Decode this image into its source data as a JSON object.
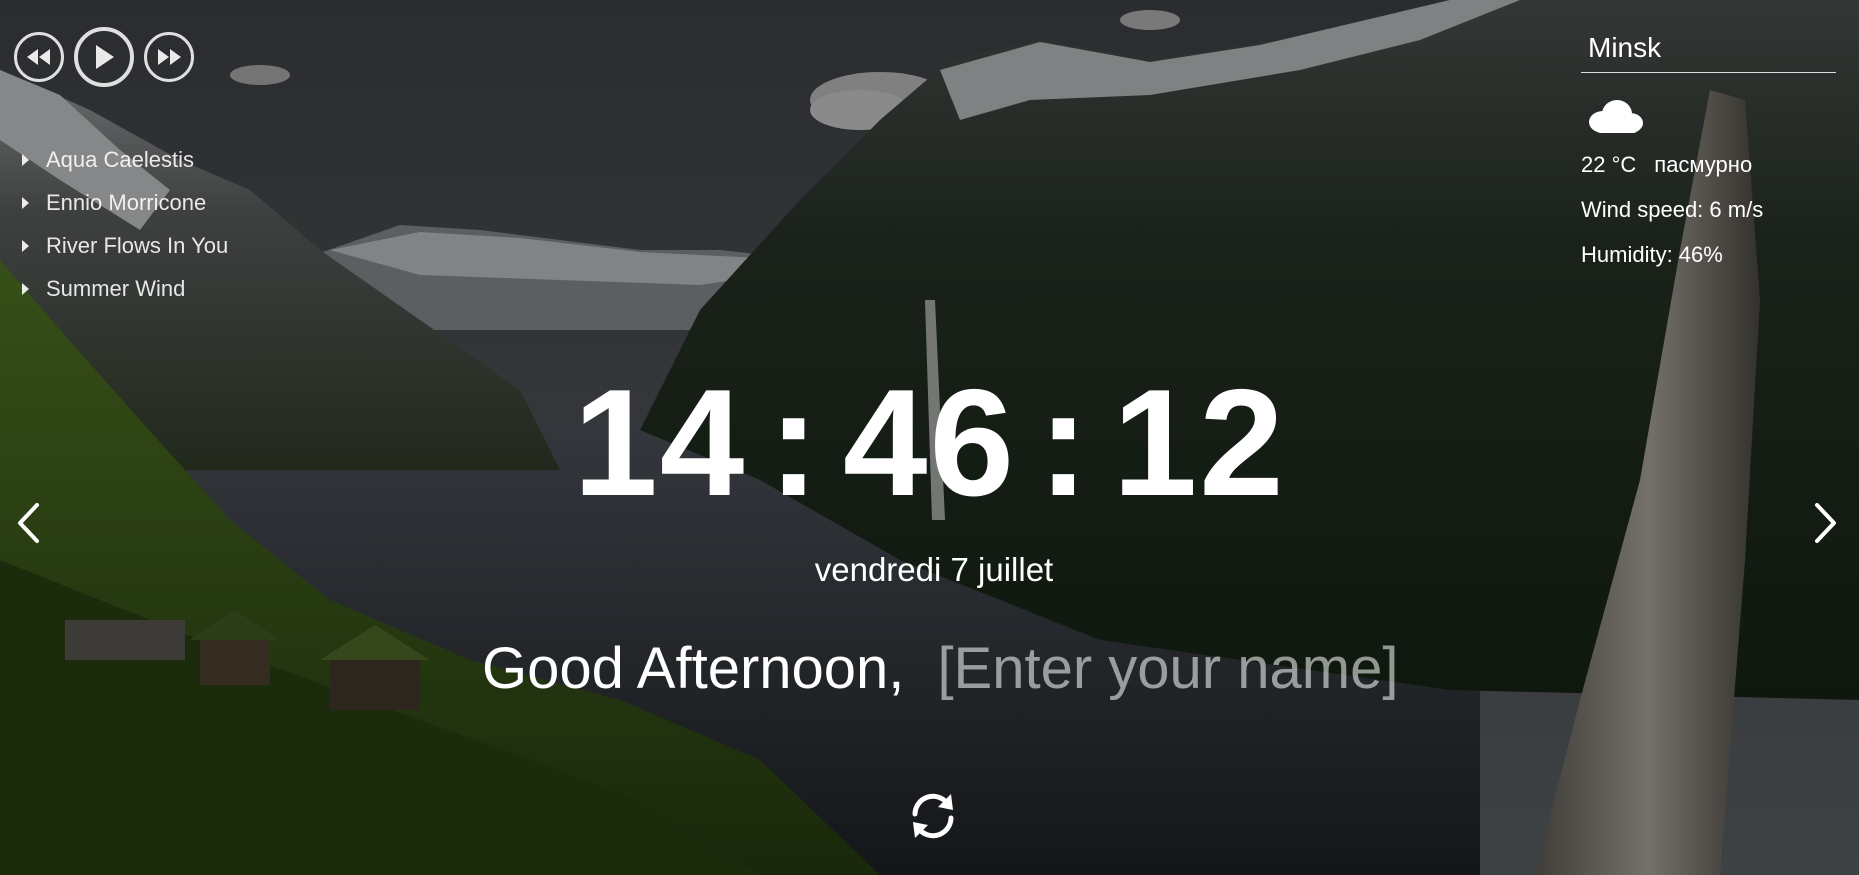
{
  "player": {
    "prev_icon": "rewind-icon",
    "play_icon": "play-icon",
    "next_icon": "fast-forward-icon"
  },
  "playlist": [
    {
      "title": "Aqua Caelestis"
    },
    {
      "title": "Ennio Morricone"
    },
    {
      "title": "River Flows In You"
    },
    {
      "title": "Summer Wind"
    }
  ],
  "weather": {
    "city": "Minsk",
    "icon": "cloud-icon",
    "temperature": "22 °C",
    "description": "пасмурно",
    "wind": "Wind speed: 6 m/s",
    "humidity": "Humidity: 46%"
  },
  "clock": {
    "hours": "14",
    "minutes": "46",
    "seconds": "12",
    "separator": ":"
  },
  "date": "vendredi 7 juillet",
  "greeting": {
    "text": "Good Afternoon,",
    "name": "[Enter your name]"
  },
  "navigation": {
    "prev_icon": "chevron-left-icon",
    "next_icon": "chevron-right-icon",
    "refresh_icon": "refresh-icon"
  },
  "colors": {
    "text": "#ffffff",
    "placeholder": "#9a9a9a",
    "overlay": "rgba(0,0,0,0.45)"
  }
}
